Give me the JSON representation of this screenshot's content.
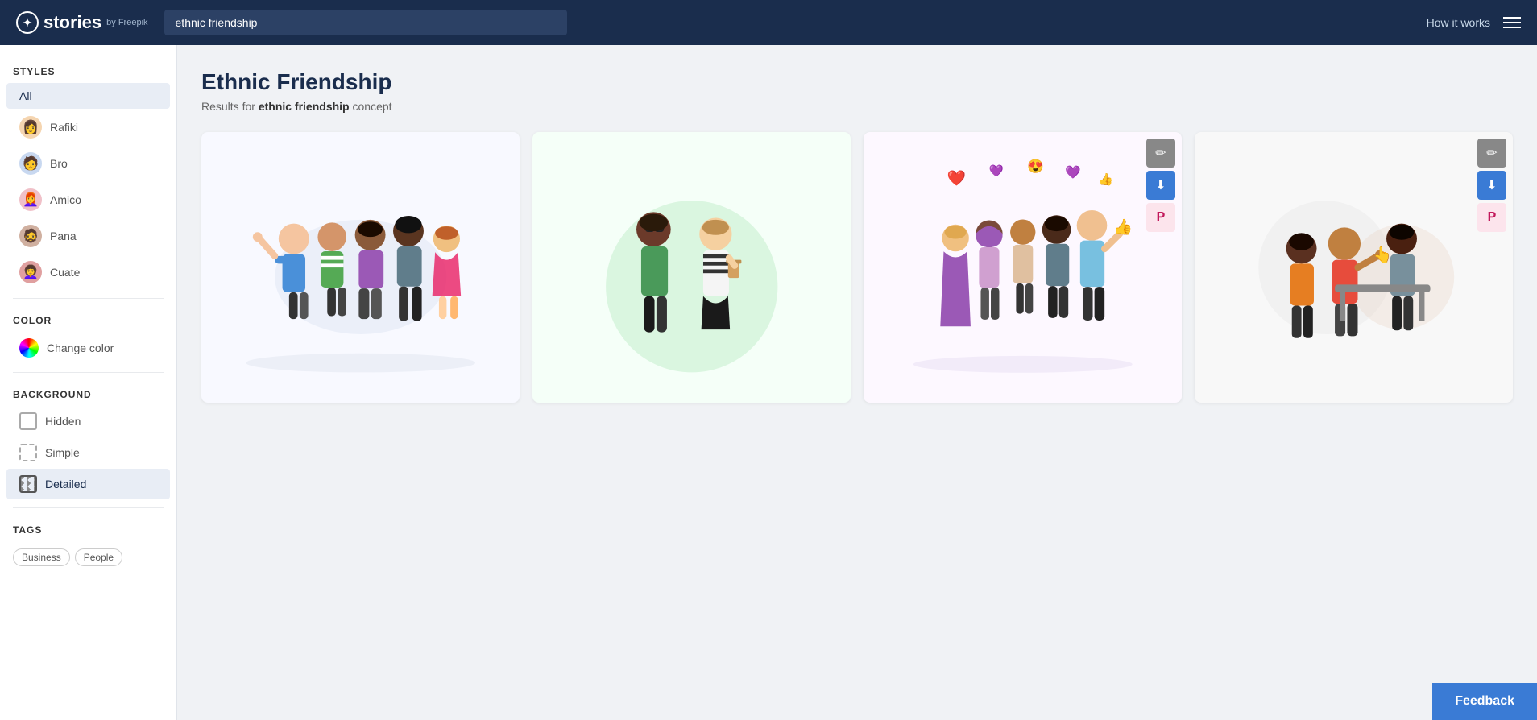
{
  "header": {
    "logo_text": "stories",
    "logo_by": "by Freepik",
    "search_placeholder": "ethnic friendship",
    "search_value": "ethnic friendship",
    "how_it_works": "How it works"
  },
  "sidebar": {
    "styles_label": "STYLES",
    "all_label": "All",
    "style_items": [
      {
        "id": "rafiki",
        "label": "Rafiki",
        "emoji": "👩"
      },
      {
        "id": "bro",
        "label": "Bro",
        "emoji": "🧑"
      },
      {
        "id": "amico",
        "label": "Amico",
        "emoji": "👩‍🦰"
      },
      {
        "id": "pana",
        "label": "Pana",
        "emoji": "🧔"
      },
      {
        "id": "cuate",
        "label": "Cuate",
        "emoji": "👩‍🦱"
      }
    ],
    "color_label": "COLOR",
    "change_color": "Change color",
    "background_label": "BACKGROUND",
    "bg_items": [
      {
        "id": "hidden",
        "label": "Hidden"
      },
      {
        "id": "simple",
        "label": "Simple"
      },
      {
        "id": "detailed",
        "label": "Detailed"
      }
    ],
    "tags_label": "TAGS",
    "tags": [
      "Business",
      "People"
    ]
  },
  "main": {
    "title": "Ethnic Friendship",
    "results_prefix": "Results for",
    "results_query": "ethnic friendship",
    "results_suffix": "concept"
  },
  "actions": {
    "edit": "✏",
    "download": "⬇",
    "pinterest": "P"
  },
  "feedback": {
    "label": "Feedback"
  }
}
